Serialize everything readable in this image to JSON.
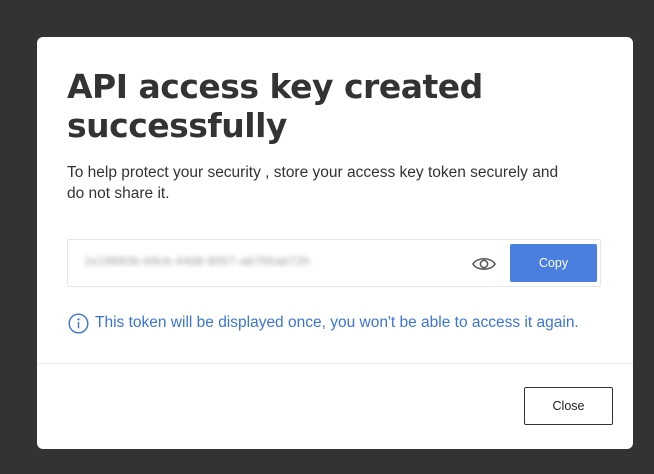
{
  "modal": {
    "title": "API access key created successfully",
    "description": "To help protect your security , store your access key token securely and do not share it.",
    "token": {
      "value": "1e19893b-b9cb-44d8-8007-ab765ab72h",
      "reveal_icon": "eye-icon",
      "copy_label": "Copy"
    },
    "notice": {
      "icon": "info-icon",
      "text": "This token will be displayed once, you won't be able to access it again."
    },
    "footer": {
      "close_label": "Close"
    }
  },
  "colors": {
    "backdrop": "#333333",
    "primary": "#4a7fe0",
    "info_text": "#3b74d6",
    "title_text": "#333333"
  }
}
